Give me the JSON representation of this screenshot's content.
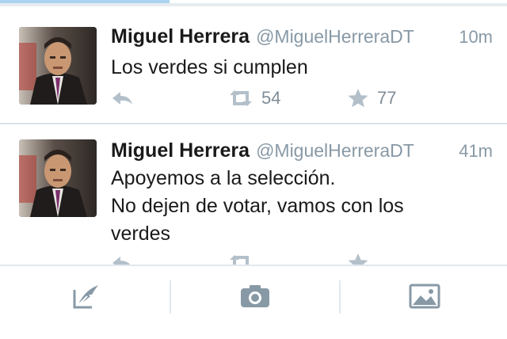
{
  "timeline": {
    "tweets": [
      {
        "author": "Miguel Herrera",
        "handle": "@MiguelHerreraDT",
        "time": "10m",
        "lines": [
          "Los verdes si cumplen"
        ],
        "retweets": "54",
        "favorites": "77"
      },
      {
        "author": "Miguel Herrera",
        "handle": "@MiguelHerreraDT",
        "time": "41m",
        "lines": [
          "Apoyemos a la selección.",
          "No dejen de votar, vamos con los",
          "verdes"
        ],
        "retweets": "",
        "favorites": ""
      }
    ]
  },
  "bottom_bar": {
    "buttons": [
      "compose-icon",
      "camera-icon",
      "image-icon"
    ]
  },
  "colors": {
    "icon_gray": "#8899a6",
    "text_dark": "#1a1a1a",
    "separator": "#dce3e8",
    "progress_accent": "#a9d3ef"
  }
}
